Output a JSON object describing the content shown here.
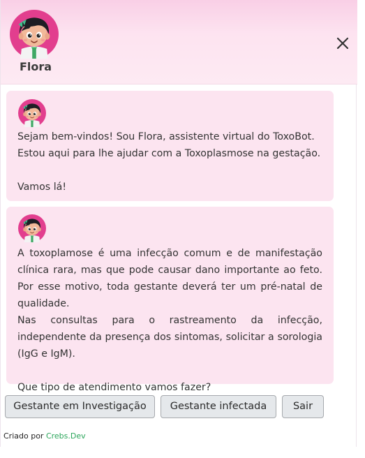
{
  "header": {
    "bot_name": "Flora",
    "avatar_icon": "flora-avatar-icon",
    "close_icon": "close-icon"
  },
  "messages": [
    {
      "sender": "Flora",
      "text": "Sejam bem-vindos! Sou Flora, assistente virtual do ToxoBot. Estou aqui para lhe ajudar com a Toxoplasmose na gestação.\n\nVamos lá!"
    },
    {
      "sender": "Flora",
      "text": "A toxoplamose é uma infecção comum e de manifestação clínica rara, mas que pode causar dano importante ao feto. Por esse motivo, toda gestante deverá ter um pré-natal de qualidade.\nNas consultas para o rastreamento da infecção, independente da presença dos sintomas, solicitar a sorologia (IgG e IgM).\n\nQue tipo de atendimento vamos fazer?"
    }
  ],
  "actions": [
    {
      "label": "Gestante em Investigação"
    },
    {
      "label": "Gestante infectada"
    },
    {
      "label": "Sair"
    }
  ],
  "footer": {
    "prefix": "Criado por ",
    "link_text": "Crebs.Dev"
  },
  "colors": {
    "header_gradient_top": "#f9cfe6",
    "bubble_bg": "#fce4f0",
    "button_bg": "#e5e8eb",
    "link": "#2aa65a",
    "avatar_circle": "#e23e8e"
  }
}
